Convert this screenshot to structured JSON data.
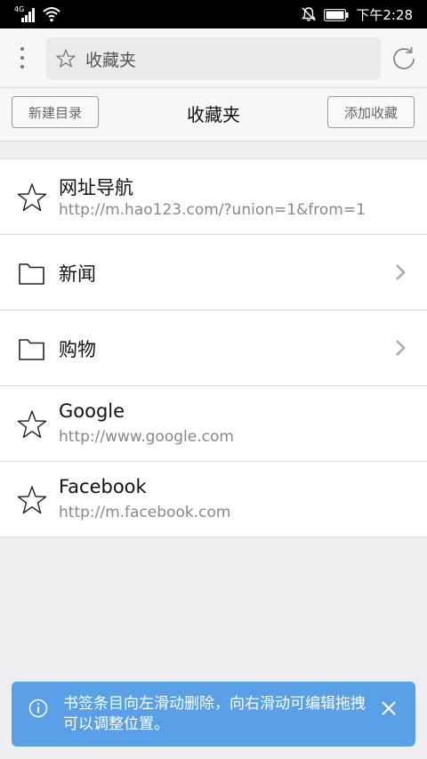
{
  "status_bar": {
    "network": "4G",
    "time": "下午2:28",
    "icons": [
      "signal-icon",
      "wifi-icon",
      "mute-bell-icon",
      "battery-icon"
    ]
  },
  "toolbar": {
    "url_text": "收藏夹",
    "icons": [
      "more-vertical-icon",
      "star-icon",
      "refresh-icon"
    ]
  },
  "header": {
    "new_folder_label": "新建目录",
    "title": "收藏夹",
    "add_bookmark_label": "添加收藏"
  },
  "items": [
    {
      "type": "bookmark",
      "title": "网址导航",
      "url": "http://m.hao123.com/?union=1&from=1"
    },
    {
      "type": "folder",
      "title": "新闻"
    },
    {
      "type": "folder",
      "title": "购物"
    },
    {
      "type": "bookmark",
      "title": "Google",
      "url": "http://www.google.com"
    },
    {
      "type": "bookmark",
      "title": "Facebook",
      "url": "http://m.facebook.com"
    }
  ],
  "toast": {
    "text": "书签条目向左滑动删除，向右滑动可编辑拖拽可以调整位置。"
  },
  "colors": {
    "toast_bg": "#5aa0e6",
    "background": "#efeff2",
    "status_bar": "#000000"
  }
}
